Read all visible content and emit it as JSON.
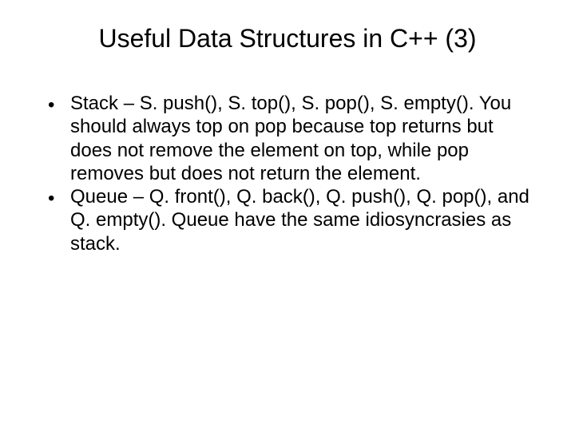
{
  "slide": {
    "title": "Useful Data Structures in C++ (3)",
    "bullets": [
      {
        "marker": "•",
        "text": "Stack – S. push(), S. top(), S. pop(), S. empty(). You should always top on pop because top returns but does not remove the element on top, while pop removes but does not return the element."
      },
      {
        "marker": "•",
        "text": "Queue – Q. front(), Q. back(), Q. push(), Q. pop(), and Q. empty(). Queue have the same idiosyncrasies as stack."
      }
    ]
  }
}
